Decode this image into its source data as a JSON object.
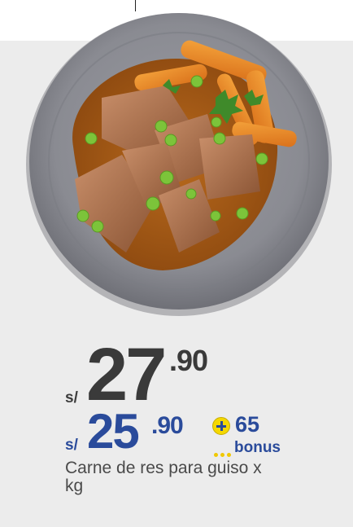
{
  "product": {
    "name": "Carne de res para guiso x kg",
    "image": "Plate of braised beef stew with carrots and peas"
  },
  "price_regular": {
    "currency": "s/",
    "integer": "27",
    "decimal": ".90"
  },
  "price_card": {
    "currency": "s/",
    "integer": "25",
    "decimal": ".90"
  },
  "bonus": {
    "points": "65",
    "label": "bonus",
    "icon": "plus-circle-icon"
  },
  "colors": {
    "accent": "#2a4b9b",
    "regular_price": "#3a3a3a",
    "bonus_yellow": "#f5d800",
    "card_background": "#ececec",
    "plate": "#8a8b92"
  }
}
